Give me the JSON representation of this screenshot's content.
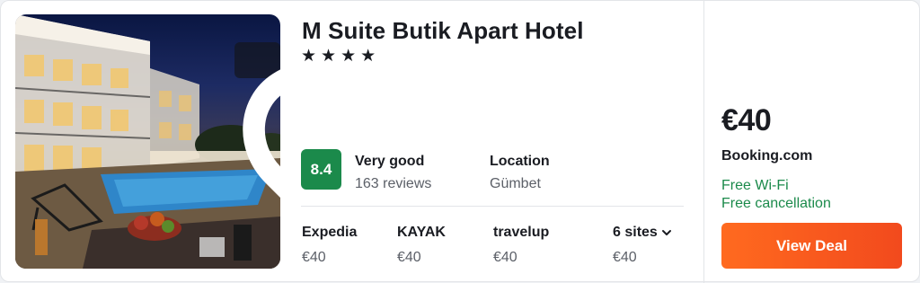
{
  "hotel": {
    "name": "M Suite Butik Apart Hotel",
    "stars": [
      "★",
      "★",
      "★",
      "★"
    ]
  },
  "rating": {
    "score": "8.4",
    "label": "Very good",
    "reviews": "163 reviews",
    "badge_color": "#1b8a4b"
  },
  "location": {
    "label": "Location",
    "value": "Gümbet"
  },
  "sites": [
    {
      "name": "Expedia",
      "price": "€40"
    },
    {
      "name": "KAYAK",
      "price": "€40"
    },
    {
      "name": "travelup",
      "price": "€40"
    }
  ],
  "more_sites": {
    "label": "6 sites",
    "price": "€40",
    "icon": "chevron-down-icon"
  },
  "deal": {
    "price": "€40",
    "provider": "Booking.com",
    "amenities": [
      "Free Wi-Fi",
      "Free cancellation"
    ],
    "button_label": "View Deal",
    "button_color": "#ff5a1f",
    "amenity_color": "#1b8a4b"
  },
  "photo": {
    "favorite_icon": "heart-icon"
  }
}
